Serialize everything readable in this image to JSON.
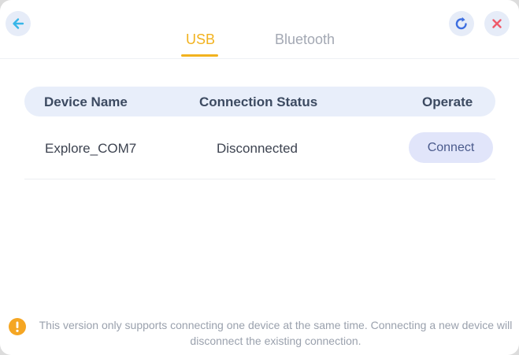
{
  "header": {
    "back_icon": "arrow-left-icon",
    "refresh_icon": "refresh-icon",
    "close_icon": "close-icon",
    "colors": {
      "back": "#38b6e8",
      "refresh": "#3d6ee0",
      "close": "#ef5a6a"
    }
  },
  "tabs": [
    {
      "label": "USB",
      "active": true,
      "color": "#f2b21e"
    },
    {
      "label": "Bluetooth",
      "active": false,
      "color": "#a3a8b3"
    }
  ],
  "table": {
    "columns": [
      "Device Name",
      "Connection Status",
      "Operate"
    ],
    "rows": [
      {
        "device_name": "Explore_COM7",
        "status": "Disconnected",
        "action": "Connect"
      }
    ]
  },
  "notice": {
    "icon": "warning-icon",
    "color": "#f5a623",
    "text": "This version only supports connecting one device at the same time. Connecting a new device will disconnect the existing connection."
  }
}
